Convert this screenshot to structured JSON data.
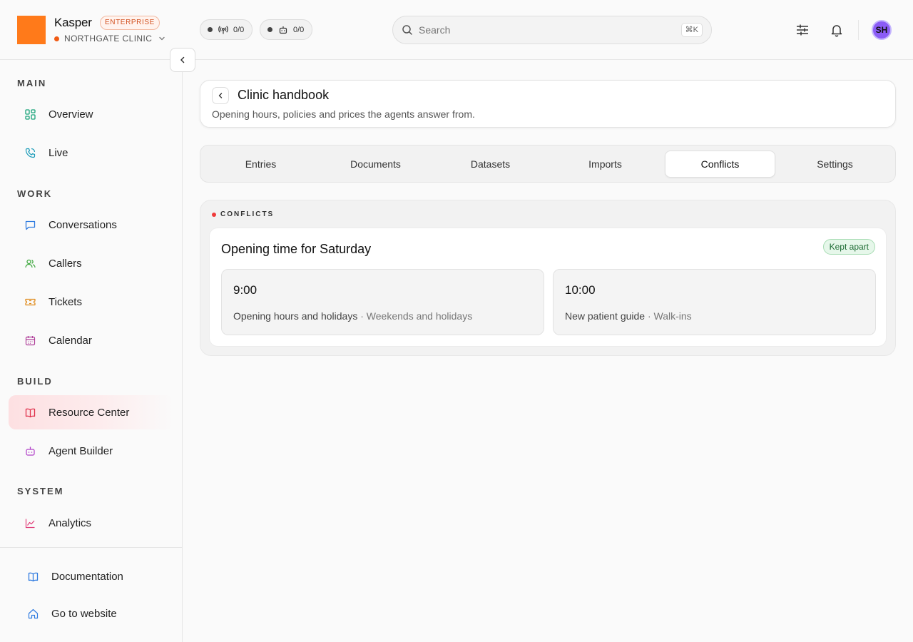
{
  "brand": {
    "name": "Kasper",
    "badge": "ENTERPRISE",
    "org": "NORTHGATE CLINIC"
  },
  "status_pills": [
    {
      "icon": "broadcast-icon",
      "value": "0/0"
    },
    {
      "icon": "robot-icon",
      "value": "0/0"
    }
  ],
  "search": {
    "placeholder": "Search",
    "shortcut": "⌘K"
  },
  "user": {
    "initials": "SH"
  },
  "sidebar": {
    "sections": [
      {
        "label": "MAIN",
        "items": [
          {
            "label": "Overview",
            "icon": "grid-icon"
          },
          {
            "label": "Live",
            "icon": "phone-icon"
          }
        ]
      },
      {
        "label": "WORK",
        "items": [
          {
            "label": "Conversations",
            "icon": "message-icon"
          },
          {
            "label": "Callers",
            "icon": "users-icon"
          },
          {
            "label": "Tickets",
            "icon": "ticket-icon"
          },
          {
            "label": "Calendar",
            "icon": "calendar-icon"
          }
        ]
      },
      {
        "label": "BUILD",
        "items": [
          {
            "label": "Resource Center",
            "icon": "book-icon",
            "active": true
          },
          {
            "label": "Agent Builder",
            "icon": "robot-icon"
          }
        ]
      },
      {
        "label": "SYSTEM",
        "items": [
          {
            "label": "Analytics",
            "icon": "chart-icon"
          }
        ]
      }
    ],
    "footer": [
      {
        "label": "Documentation",
        "icon": "book-icon"
      },
      {
        "label": "Go to website",
        "icon": "home-icon"
      }
    ]
  },
  "page": {
    "title": "Clinic handbook",
    "subtitle": "Opening hours, policies and prices the agents answer from."
  },
  "tabs": [
    {
      "label": "Entries"
    },
    {
      "label": "Documents"
    },
    {
      "label": "Datasets"
    },
    {
      "label": "Imports"
    },
    {
      "label": "Conflicts",
      "active": true
    },
    {
      "label": "Settings"
    }
  ],
  "conflicts": {
    "label": "CONFLICTS",
    "items": [
      {
        "title": "Opening time for Saturday",
        "status": "Kept apart",
        "options": [
          {
            "value": "9:00",
            "source": "Opening hours and holidays",
            "section": "Weekends and holidays"
          },
          {
            "value": "10:00",
            "source": "New patient guide",
            "section": "Walk-ins"
          }
        ]
      }
    ]
  },
  "colors": {
    "brand": "#ff7a1a",
    "active_nav": "#fde0e2",
    "conflict_dot": "#ef3a3a",
    "badge_green": "#e6f7ea"
  }
}
